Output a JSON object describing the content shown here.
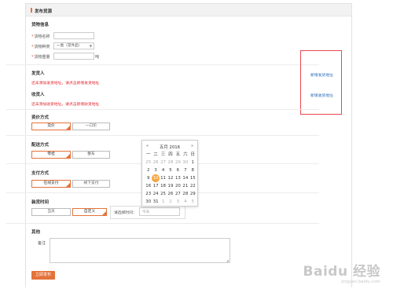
{
  "header": {
    "title": "发布货源"
  },
  "cargo": {
    "section_title": "货物信息",
    "name_label": "货物名称",
    "type_label": "货物种类",
    "type_value": "一类（常件品）",
    "weight_label": "货物重量",
    "weight_unit": "吨",
    "required_mark": "*"
  },
  "sender": {
    "section_title": "发货人",
    "warning": "还未添加发货地址，请点击新增发货地址",
    "add_link": "新增发货地址"
  },
  "receiver": {
    "section_title": "收货人",
    "warning": "还未添加收货地址，请点击新增收货地址",
    "add_link": "新增收货地址"
  },
  "pricing": {
    "section_title": "资价方式",
    "options": [
      "竞价",
      "一口价"
    ],
    "selected": 0
  },
  "delivery": {
    "section_title": "配送方式",
    "options": [
      "零担",
      "整车"
    ],
    "selected": 0
  },
  "payment": {
    "section_title": "支付方式",
    "options": [
      "在线支付",
      "线下支付"
    ],
    "selected": 0
  },
  "pickup": {
    "section_title": "装货时间",
    "options": [
      "当天",
      "自定义"
    ],
    "selected": 1,
    "time_label": "请选择时间：",
    "time_placeholder": "今天"
  },
  "other": {
    "section_title": "其他",
    "remark_label": "备注",
    "resize_glyph": "◢"
  },
  "submit_label": "立即发布",
  "calendar": {
    "prev": "«",
    "next": "»",
    "month_label": "五月 2016",
    "weekdays": [
      "一",
      "二",
      "三",
      "四",
      "五",
      "六",
      "日"
    ],
    "weeks": [
      [
        {
          "d": "25",
          "o": true
        },
        {
          "d": "26",
          "o": true
        },
        {
          "d": "27",
          "o": true
        },
        {
          "d": "28",
          "o": true
        },
        {
          "d": "29",
          "o": true
        },
        {
          "d": "30",
          "o": true
        },
        {
          "d": "1",
          "o": false
        }
      ],
      [
        {
          "d": "2",
          "o": false
        },
        {
          "d": "3",
          "o": false
        },
        {
          "d": "4",
          "o": false
        },
        {
          "d": "5",
          "o": false
        },
        {
          "d": "6",
          "o": false
        },
        {
          "d": "7",
          "o": false
        },
        {
          "d": "8",
          "o": false
        }
      ],
      [
        {
          "d": "9",
          "o": false
        },
        {
          "d": "10",
          "o": false,
          "today": true
        },
        {
          "d": "11",
          "o": false
        },
        {
          "d": "12",
          "o": false
        },
        {
          "d": "13",
          "o": false
        },
        {
          "d": "14",
          "o": false
        },
        {
          "d": "15",
          "o": false
        }
      ],
      [
        {
          "d": "16",
          "o": false
        },
        {
          "d": "17",
          "o": false
        },
        {
          "d": "18",
          "o": false
        },
        {
          "d": "19",
          "o": false
        },
        {
          "d": "20",
          "o": false
        },
        {
          "d": "21",
          "o": false
        },
        {
          "d": "22",
          "o": false
        }
      ],
      [
        {
          "d": "23",
          "o": false
        },
        {
          "d": "24",
          "o": false
        },
        {
          "d": "25",
          "o": false
        },
        {
          "d": "26",
          "o": false
        },
        {
          "d": "27",
          "o": false
        },
        {
          "d": "28",
          "o": false
        },
        {
          "d": "29",
          "o": false
        }
      ],
      [
        {
          "d": "30",
          "o": false
        },
        {
          "d": "31",
          "o": false
        },
        {
          "d": "1",
          "o": true
        },
        {
          "d": "2",
          "o": true
        },
        {
          "d": "3",
          "o": true
        },
        {
          "d": "4",
          "o": true
        },
        {
          "d": "5",
          "o": true
        }
      ]
    ]
  },
  "watermark": {
    "logo": "Baidu 经验",
    "url": "jingyan.baidu.com"
  },
  "colors": {
    "accent": "#e4733a",
    "warning": "#e4262f",
    "link": "#2b6cb8",
    "highlight_box": "#e8494f",
    "today": "#f5a640"
  }
}
